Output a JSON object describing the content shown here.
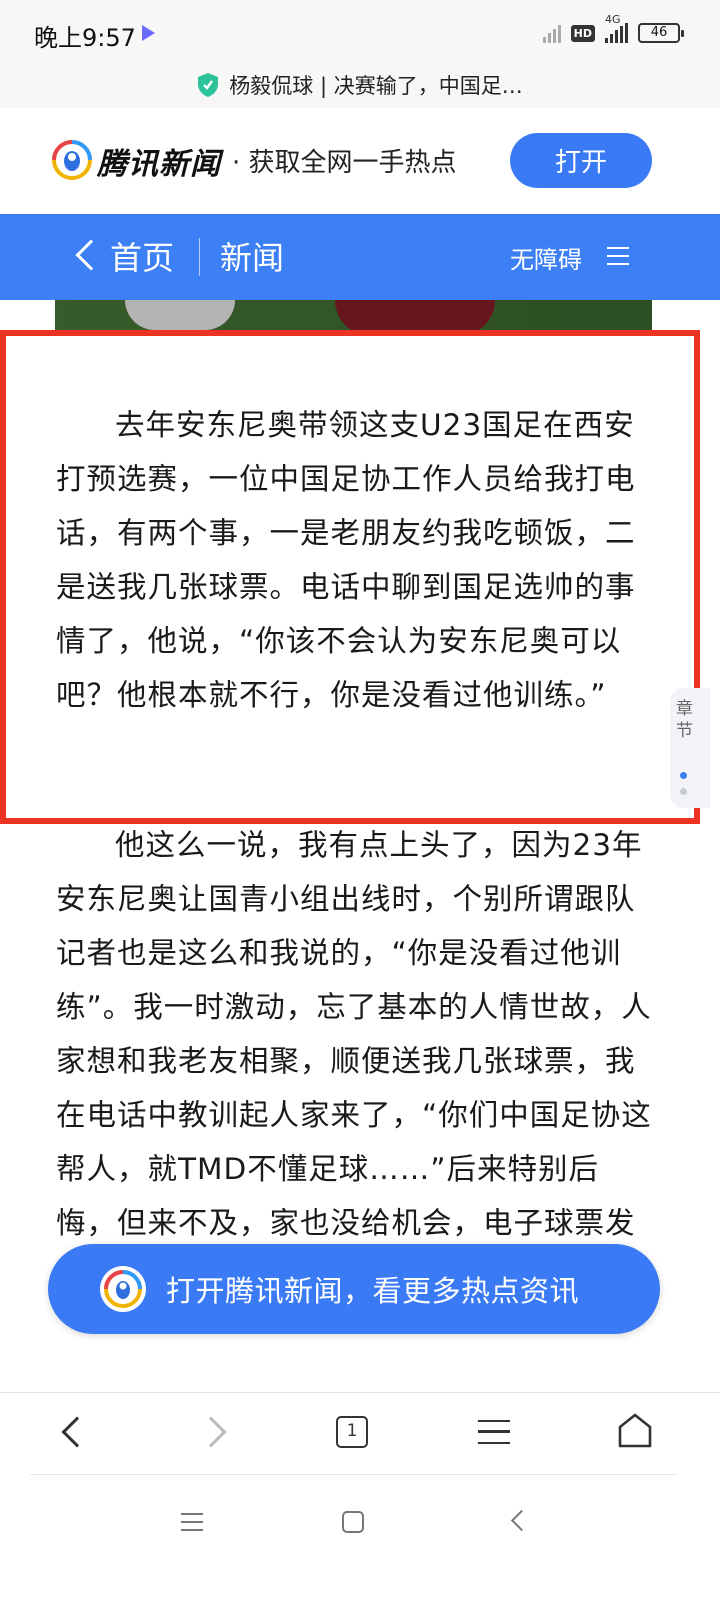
{
  "status_bar": {
    "time": "晚上9:57",
    "hd": "HD",
    "network": "4G",
    "battery": "46"
  },
  "page": {
    "title": "杨毅侃球 | 决赛输了，中国足…"
  },
  "app_banner": {
    "brand": "腾讯新闻",
    "tagline": "· 获取全网一手热点",
    "open_label": "打开"
  },
  "nav": {
    "home": "首页",
    "section": "新闻",
    "accessibility": "无障碍"
  },
  "article": {
    "paragraphs": [
      "去年安东尼奥带领这支U23国足在西安打预选赛，一位中国足协工作人员给我打电话，有两个事，一是老朋友约我吃顿饭，二是送我几张球票。电话中聊到国足选帅的事情了，他说，“你该不会认为安东尼奥可以吧？他根本就不行，你是没看过他训练。”",
      "他这么一说，我有点上头了，因为23年安东尼奥让国青小组出线时，个别所谓跟队记者也是这么和我说的，“你是没看过他训练”。我一时激动，忘了基本的人情世故，人家想和我老友相聚，顺便送我几张球票，我在电话中教训起人家来了，“你们中国足协这帮人，就TMD不懂足球……”后来特别后悔，但来不及，家也没给机会，电子球票发过来就不搭理我了。"
    ]
  },
  "side_tab": {
    "text": "章节"
  },
  "cta": {
    "label": "打开腾讯新闻，看更多热点资讯"
  },
  "toolbar": {
    "tab_count": "1"
  },
  "colors": {
    "brand_blue": "#3d7ff5",
    "highlight_red": "#ec3323"
  }
}
